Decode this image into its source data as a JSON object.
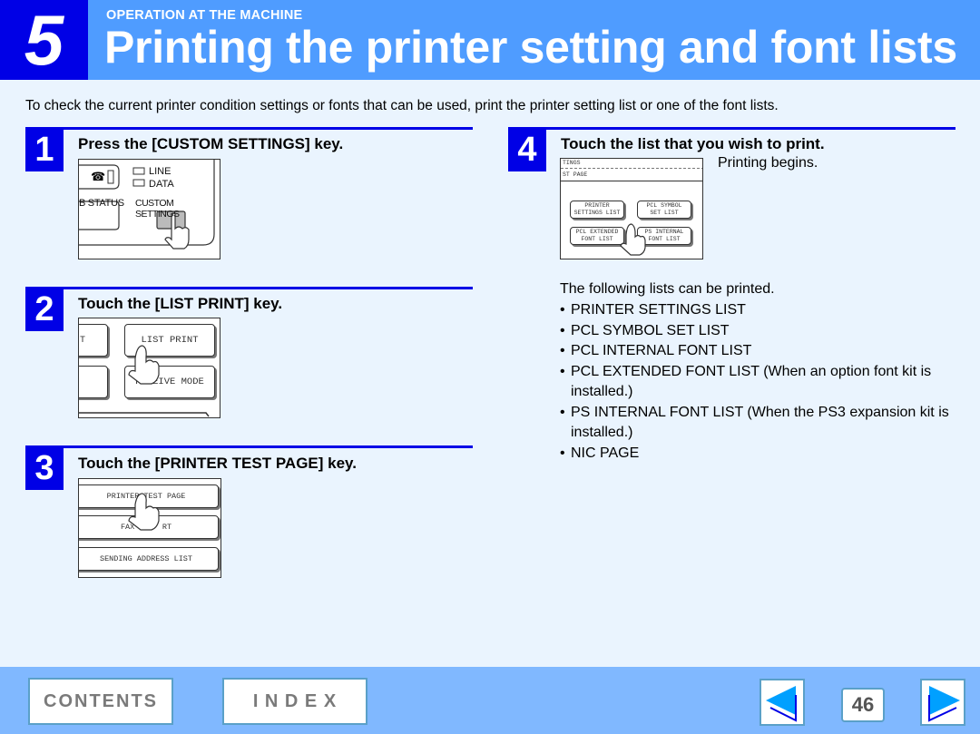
{
  "header": {
    "chapter_number": "5",
    "section_label": "OPERATION AT THE MACHINE",
    "title": "Printing the printer setting and font lists"
  },
  "intro": "To check the current printer condition settings or fonts that can be used, print the printer setting list or one of the font lists.",
  "steps": [
    {
      "number": "1",
      "title": "Press the [CUSTOM SETTINGS] key.",
      "panel": {
        "indicator_line": "LINE",
        "indicator_data": "DATA",
        "left_label": "B STATUS",
        "key_label": "CUSTOM SETTINGS"
      }
    },
    {
      "number": "2",
      "title": "Touch the [LIST PRINT] key.",
      "panel": {
        "left_fragment": "T",
        "key_top": "LIST PRINT",
        "key_bottom": "RECEIVE MODE"
      }
    },
    {
      "number": "3",
      "title": "Touch the [PRINTER TEST PAGE] key.",
      "panel": {
        "key_1": "PRINTER TEST PAGE",
        "key_2": "FAX      RT",
        "key_3": "SENDING ADDRESS LIST"
      }
    },
    {
      "number": "4",
      "title": "Touch the list that you wish to print.",
      "note": "Printing begins.",
      "panel": {
        "row_1": "TINGS",
        "row_2": "ST PAGE",
        "key_1_line1": "PRINTER",
        "key_1_line2": "SETTINGS LIST",
        "key_2_line1": "PCL SYMBOL",
        "key_2_line2": "SET LIST",
        "key_3_line1": "PCL EXTENDED",
        "key_3_line2": "FONT LIST",
        "key_4_line1": "PS INTERNAL",
        "key_4_line2": "FONT LIST"
      }
    }
  ],
  "lists": {
    "intro": "The following lists can be printed.",
    "bullet": "•",
    "items": [
      "PRINTER SETTINGS LIST",
      "PCL SYMBOL SET LIST",
      "PCL INTERNAL FONT LIST",
      "PCL EXTENDED FONT LIST (When an option font kit is installed.)",
      "PS INTERNAL FONT LIST (When the PS3 expansion kit is installed.)",
      "NIC PAGE"
    ]
  },
  "footer": {
    "contents_label": "CONTENTS",
    "index_label": "I N D E X",
    "page_number": "46",
    "prev_icon": "left-triangle-arrow",
    "next_icon": "right-triangle-arrow"
  },
  "colors": {
    "header_bg": "#4f9cff",
    "chapter_bg": "#0000e6",
    "page_bg": "#eaf4fe",
    "footer_bg": "#80b8ff",
    "arrow_fill": "#00a0ff"
  }
}
